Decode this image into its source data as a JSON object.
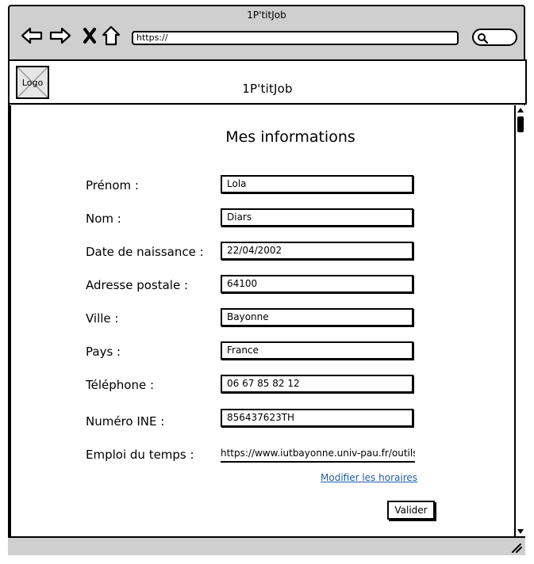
{
  "browser": {
    "title": "1P'titJob",
    "url": "https://",
    "nav_icons": [
      "back-arrow-icon",
      "forward-arrow-icon",
      "close-icon",
      "home-icon"
    ],
    "search_icon": "search-icon"
  },
  "header": {
    "logo_label": "Logo",
    "site_title": "1P'titJob"
  },
  "form": {
    "heading": "Mes informations",
    "fields": [
      {
        "label": "Prénom :",
        "value": "Lola"
      },
      {
        "label": "Nom :",
        "value": "Diars"
      },
      {
        "label": "Date de naissance :",
        "value": "22/04/2002"
      },
      {
        "label": "Adresse postale :",
        "value": "64100"
      },
      {
        "label": "Ville :",
        "value": "Bayonne"
      },
      {
        "label": "Pays :",
        "value": "France"
      },
      {
        "label": "Téléphone :",
        "value": "06 67 85 82 12"
      },
      {
        "label": "Numéro INE :",
        "value": "856437623TH"
      }
    ],
    "schedule": {
      "label": "Emploi du temps :",
      "value": "https://www.iutbayonne.univ-pau.fr/outils"
    },
    "modify_link": "Modifier les horaires",
    "submit_label": "Valider"
  },
  "colors": {
    "chrome": "#cfcfcf",
    "link": "#1f5fa8",
    "ink": "#000000"
  }
}
